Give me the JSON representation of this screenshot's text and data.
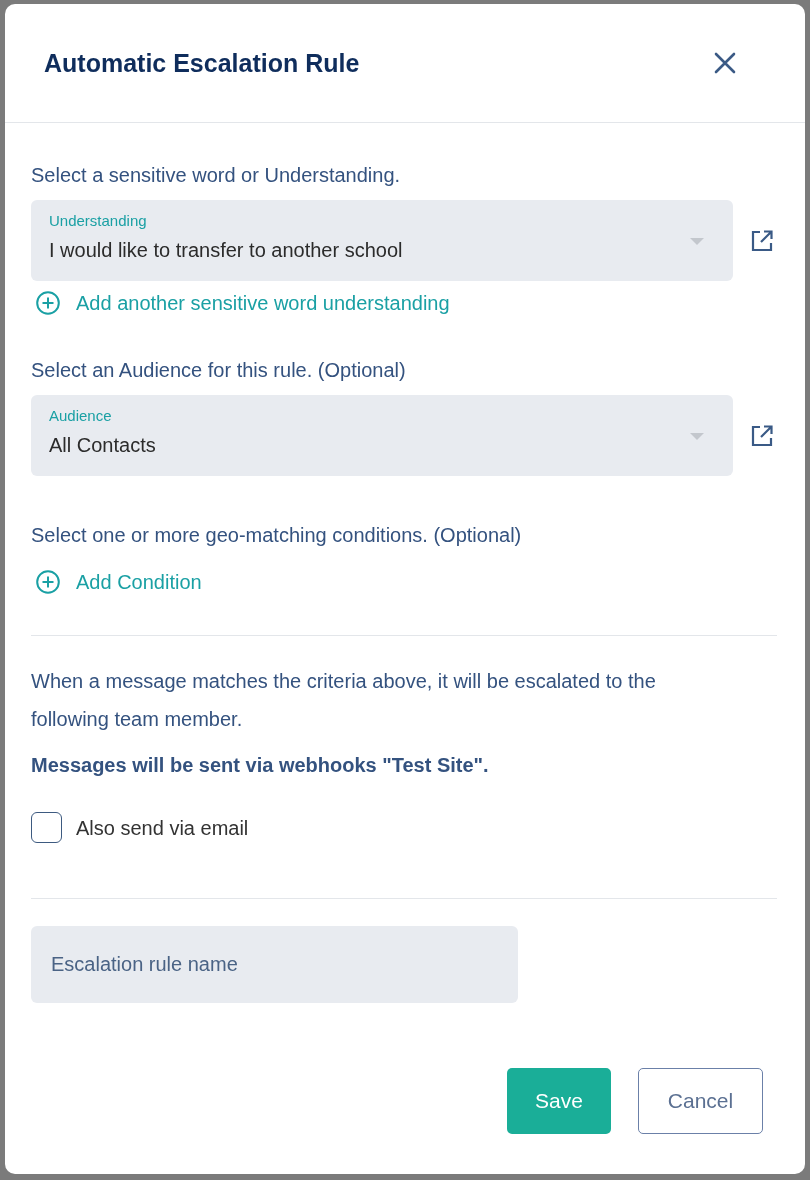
{
  "dialog": {
    "title": "Automatic Escalation Rule"
  },
  "understanding": {
    "prompt": "Select a sensitive word or Understanding.",
    "select": {
      "label": "Understanding",
      "value": "I would like to transfer to another school"
    },
    "add_link": "Add another sensitive word understanding"
  },
  "audience": {
    "prompt": "Select an Audience for this rule. (Optional)",
    "select": {
      "label": "Audience",
      "value": "All Contacts"
    }
  },
  "geo_conditions": {
    "prompt": "Select one or more geo-matching conditions. (Optional)",
    "add_link": "Add Condition"
  },
  "escalation": {
    "description": "When a message matches the criteria above, it will be escalated to the following team member.",
    "webhook_note": "Messages will be sent via webhooks \"Test Site\".",
    "email_option": {
      "label": "Also send via email",
      "checked": false
    }
  },
  "rule_name": {
    "placeholder": "Escalation rule name"
  },
  "buttons": [
    {
      "label": "Save",
      "kind": "primary"
    },
    {
      "label": "Cancel",
      "kind": "secondary"
    }
  ]
}
